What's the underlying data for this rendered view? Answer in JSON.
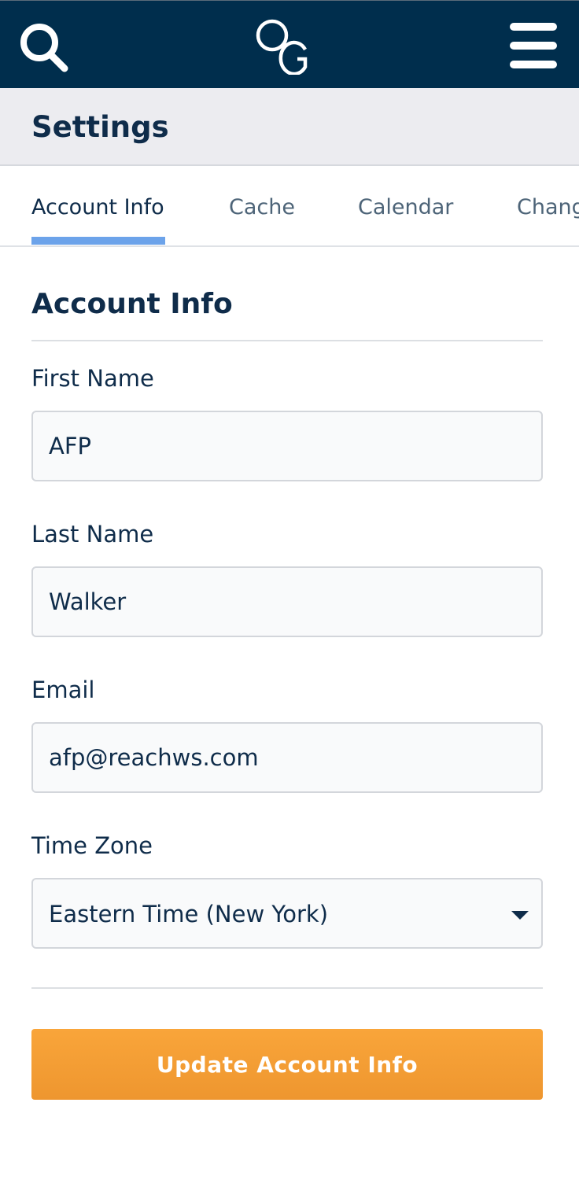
{
  "header": {
    "logo_text": "OG",
    "icons": {
      "search": "search-icon",
      "menu": "hamburger-menu-icon"
    },
    "background_color": "#002e4d"
  },
  "page": {
    "title": "Settings"
  },
  "tabs": [
    {
      "label": "Account Info",
      "active": true
    },
    {
      "label": "Cache",
      "active": false
    },
    {
      "label": "Calendar",
      "active": false
    },
    {
      "label": "Chang",
      "active": false
    }
  ],
  "form": {
    "section_title": "Account Info",
    "first_name": {
      "label": "First Name",
      "value": "AFP"
    },
    "last_name": {
      "label": "Last Name",
      "value": "Walker"
    },
    "email": {
      "label": "Email",
      "value": "afp@reachws.com"
    },
    "time_zone": {
      "label": "Time Zone",
      "value": "Eastern Time (New York)"
    },
    "submit_label": "Update Account Info"
  },
  "colors": {
    "accent": "#f9a53a",
    "tab_indicator": "#6ca3ea",
    "text": "#0f2c4a"
  }
}
